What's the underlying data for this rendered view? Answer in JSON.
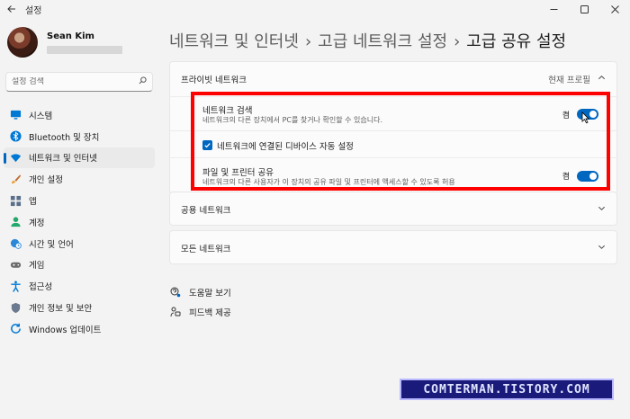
{
  "window": {
    "app_title": "설정",
    "back_icon": "arrow-left-icon",
    "controls": [
      "minimize-icon",
      "maximize-icon",
      "close-icon"
    ]
  },
  "profile": {
    "name": "Sean Kim"
  },
  "search": {
    "placeholder": "설정 검색"
  },
  "sidebar": {
    "items": [
      {
        "label": "시스템",
        "icon": "system-icon",
        "active": false
      },
      {
        "label": "Bluetooth 및 장치",
        "icon": "bluetooth-icon",
        "active": false
      },
      {
        "label": "네트워크 및 인터넷",
        "icon": "wifi-icon",
        "active": true
      },
      {
        "label": "개인 설정",
        "icon": "brush-icon",
        "active": false
      },
      {
        "label": "앱",
        "icon": "apps-icon",
        "active": false
      },
      {
        "label": "계정",
        "icon": "account-icon",
        "active": false
      },
      {
        "label": "시간 및 언어",
        "icon": "globe-clock-icon",
        "active": false
      },
      {
        "label": "게임",
        "icon": "gamepad-icon",
        "active": false
      },
      {
        "label": "접근성",
        "icon": "accessibility-icon",
        "active": false
      },
      {
        "label": "개인 정보 및 보안",
        "icon": "shield-icon",
        "active": false
      },
      {
        "label": "Windows 업데이트",
        "icon": "update-icon",
        "active": false
      }
    ],
    "accent": "#0067c0"
  },
  "breadcrumb": {
    "items": [
      "네트워크 및 인터넷",
      "고급 네트워크 설정",
      "고급 공유 설정"
    ],
    "separator": "›"
  },
  "private_network": {
    "title": "프라이빗 네트워크",
    "status": "현재 프로필",
    "network_discovery": {
      "title": "네트워크 검색",
      "description": "네트워크의 다른 장치에서 PC를 찾거나 확인할 수 있습니다.",
      "toggle_label": "켬",
      "on": true
    },
    "auto_setup": {
      "label": "네트워크에 연결된 디바이스 자동 설정",
      "checked": true
    },
    "file_sharing": {
      "title": "파일 및 프린터 공유",
      "description": "네트워크의 다른 사용자가 이 장치의 공유 파일 및 프린터에 액세스할 수 있도록 허용",
      "toggle_label": "켬",
      "on": true
    }
  },
  "public_network": {
    "title": "공용 네트워크"
  },
  "all_networks": {
    "title": "모든 네트워크"
  },
  "links": {
    "help": "도움말 보기",
    "feedback": "피드백 제공"
  },
  "highlight_color": "#ff0000",
  "watermark": "COMTERMAN.TISTORY.COM"
}
